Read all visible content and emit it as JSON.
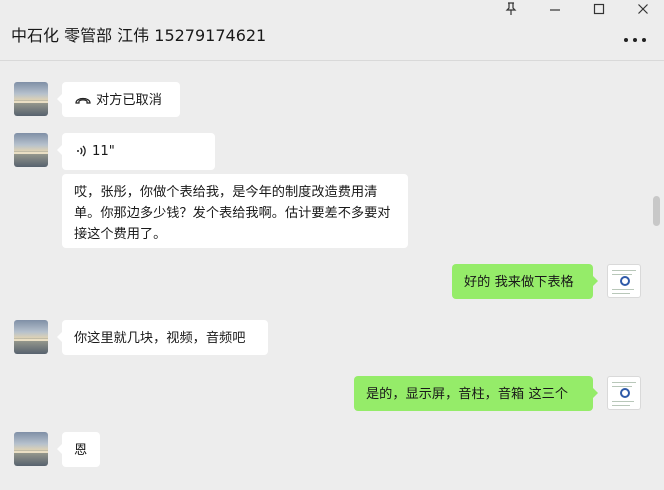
{
  "header": {
    "title": "中石化 零管部 江伟 15279174621"
  },
  "window_controls": [
    "pin-icon",
    "minimize-icon",
    "maximize-icon",
    "close-icon"
  ],
  "messages": [
    {
      "side": "left",
      "type": "call",
      "icon": "hangup-icon",
      "text": "对方已取消"
    },
    {
      "side": "left",
      "type": "voice",
      "icon": "voice-icon",
      "text": "11\""
    },
    {
      "side": "left",
      "type": "text",
      "text": "哎，张彤，你做个表给我，是今年的制度改造费用清单。你那边多少钱？发个表给我啊。估计要差不多要对接这个费用了。"
    },
    {
      "side": "right",
      "type": "text",
      "text": "好的 我来做下表格"
    },
    {
      "side": "left",
      "type": "text",
      "text": "你这里就几块，视频，音频吧"
    },
    {
      "side": "right",
      "type": "text",
      "text": "是的，显示屏，音柱，音箱 这三个"
    },
    {
      "side": "left",
      "type": "text",
      "text": "恩"
    }
  ],
  "colors": {
    "background": "#ededed",
    "left_bubble": "#ffffff",
    "right_bubble": "#95ec69"
  }
}
